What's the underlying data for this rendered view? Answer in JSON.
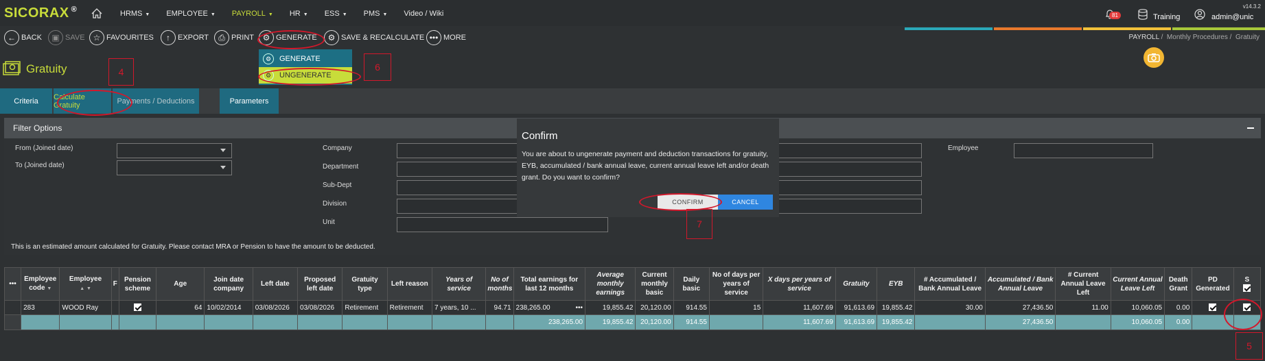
{
  "brand": {
    "name": "SICORAX",
    "mark": "®"
  },
  "version": "v14.3.2",
  "nav": {
    "items": [
      {
        "label": "HRMS",
        "caret": "▼"
      },
      {
        "label": "EMPLOYEE",
        "caret": "▼"
      },
      {
        "label": "PAYROLL",
        "caret": "▼",
        "active": true
      },
      {
        "label": "HR",
        "caret": "▼"
      },
      {
        "label": "ESS",
        "caret": "▼"
      },
      {
        "label": "PMS",
        "caret": "▼"
      },
      {
        "label": "Video / Wiki",
        "caret": ""
      }
    ],
    "notifications": "81",
    "training": "Training",
    "user": "admin@unic"
  },
  "toolbar": {
    "back": "BACK",
    "save": "SAVE",
    "favourites": "FAVOURITES",
    "export": "EXPORT",
    "print": "PRINT",
    "generate": "GENERATE",
    "save_recalc": "SAVE & RECALCULATE",
    "more": "MORE"
  },
  "breadcrumb": {
    "b1": "PAYROLL",
    "sep": "/",
    "b2": "Monthly Procedures",
    "b3": "Gratuity"
  },
  "dropdown": {
    "generate": "GENERATE",
    "ungenerate": "UNGENERATE"
  },
  "page_title": "Gratuity",
  "tabs": [
    "Criteria",
    "Calculate Gratuity",
    "Payments / Deductions",
    "Parameters"
  ],
  "filter": {
    "title": "Filter Options",
    "from_label": "From (Joined date)",
    "to_label": "To (Joined date)",
    "company": "Company",
    "department": "Department",
    "subdept": "Sub-Dept",
    "division": "Division",
    "unit": "Unit",
    "employee": "Employee",
    "note": "This is an estimated amount calculated for Gratuity. Please contact MRA or Pension to have the amount to be deducted."
  },
  "modal": {
    "title": "Confirm",
    "message": "You are about to ungenerate payment and deduction transactions for gratuity, EYB, accumulated / bank annual leave, current annual leave left and/or death grant. Do you want to confirm?",
    "confirm": "CONFIRM",
    "cancel": "CANCEL"
  },
  "grid": {
    "menu": "•••",
    "columns": [
      "Employee code",
      "Employee",
      "F",
      "Pension scheme",
      "Age",
      "Join date company",
      "Left date",
      "Proposed left date",
      "Gratuity type",
      "Left reason",
      "Years of service",
      "No of months",
      "Total earnings for last 12 months",
      "Average monthly earnings",
      "Current monthly basic",
      "Daily basic",
      "No of days per years of service",
      "X days per years of service",
      "Gratuity",
      "EYB",
      "# Accumulated / Bank Annual Leave",
      "Accumulated / Bank Annual Leave",
      "# Current Annual Leave Left",
      "Current Annual Leave Left",
      "Death Grant",
      "PD Generated",
      "S"
    ],
    "row": {
      "code": "283",
      "employee": "WOOD Ray",
      "age": "64",
      "join": "10/02/2014",
      "left": "03/08/2026",
      "proposed": "03/08/2026",
      "type": "Retirement",
      "reason": "Retirement",
      "years": "7 years, 10 ...",
      "months": "94.71",
      "total": "238,265.00",
      "dots": "•••",
      "avg": "19,855.42",
      "basic": "20,120.00",
      "daily": "914.55",
      "days": "15",
      "xdays": "11,607.69",
      "gratuity": "91,613.69",
      "eyb": "19,855.42",
      "acc_n": "30.00",
      "acc": "27,436.50",
      "cur_n": "11.00",
      "cur": "10,060.05",
      "death": "0.00"
    },
    "totals": {
      "total": "238,265.00",
      "avg": "19,855.42",
      "basic": "20,120.00",
      "daily": "914.55",
      "xdays": "11,607.69",
      "gratuity": "91,613.69",
      "eyb": "19,855.42",
      "acc": "27,436.50",
      "cur": "10,060.05",
      "death": "0.00"
    }
  },
  "annotations": [
    "4",
    "6",
    "7",
    "5"
  ],
  "colors": {
    "accent": "#c8dc3a",
    "teal": "#1f6a80",
    "marker": "#d3182b",
    "confirm_blue": "#2f86e0"
  }
}
